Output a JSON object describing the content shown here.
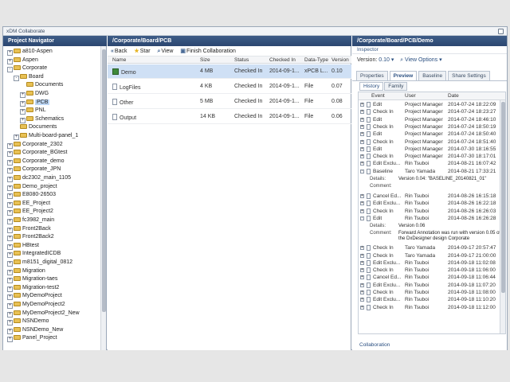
{
  "app_title": "xDM Collaborate",
  "panels": {
    "navigator_title": "Project Navigator",
    "middle_path": "/Corporate/Board/PCB",
    "right_path": "/Corporate/Board/PCB/Demo",
    "inspector_label": "Inspector"
  },
  "navigator": {
    "items": [
      {
        "label": "a810-Aspen",
        "indent": 0,
        "toggle": "+"
      },
      {
        "label": "Aspen",
        "indent": 0,
        "toggle": "+"
      },
      {
        "label": "Corporate",
        "indent": 0,
        "toggle": "-"
      },
      {
        "label": "Board",
        "indent": 1,
        "toggle": "-"
      },
      {
        "label": "Documents",
        "indent": 2,
        "toggle": ""
      },
      {
        "label": "DWG",
        "indent": 2,
        "toggle": "+"
      },
      {
        "label": "PCB",
        "indent": 2,
        "toggle": "+",
        "selected": true
      },
      {
        "label": "PNL",
        "indent": 2,
        "toggle": "+"
      },
      {
        "label": "Schematics",
        "indent": 2,
        "toggle": "+"
      },
      {
        "label": "Documents",
        "indent": 1,
        "toggle": ""
      },
      {
        "label": "Multi-board-panel_1",
        "indent": 1,
        "toggle": "+"
      },
      {
        "label": "Corporate_2302",
        "indent": 0,
        "toggle": "+"
      },
      {
        "label": "Corporate_BGtest",
        "indent": 0,
        "toggle": "+"
      },
      {
        "label": "Corporate_demo",
        "indent": 0,
        "toggle": "+"
      },
      {
        "label": "Corporate_JPN",
        "indent": 0,
        "toggle": "+"
      },
      {
        "label": "dc2302_main_1105",
        "indent": 0,
        "toggle": "+"
      },
      {
        "label": "Demo_project",
        "indent": 0,
        "toggle": "+"
      },
      {
        "label": "E8080-26503",
        "indent": 0,
        "toggle": "+"
      },
      {
        "label": "EE_Project",
        "indent": 0,
        "toggle": "+"
      },
      {
        "label": "EE_Project2",
        "indent": 0,
        "toggle": "+"
      },
      {
        "label": "fc3982_main",
        "indent": 0,
        "toggle": "+"
      },
      {
        "label": "Front2Back",
        "indent": 0,
        "toggle": "+"
      },
      {
        "label": "Front2Back2",
        "indent": 0,
        "toggle": "+"
      },
      {
        "label": "HBtest",
        "indent": 0,
        "toggle": "+"
      },
      {
        "label": "IntegratedICDB",
        "indent": 0,
        "toggle": "+"
      },
      {
        "label": "m8151_digital_0812",
        "indent": 0,
        "toggle": "+"
      },
      {
        "label": "Migration",
        "indent": 0,
        "toggle": "+"
      },
      {
        "label": "Migration-taes",
        "indent": 0,
        "toggle": "+"
      },
      {
        "label": "Migration-test2",
        "indent": 0,
        "toggle": "+"
      },
      {
        "label": "MyDemoProject",
        "indent": 0,
        "toggle": "+"
      },
      {
        "label": "MyDemoProject2",
        "indent": 0,
        "toggle": "+"
      },
      {
        "label": "MyDemoProject2_New",
        "indent": 0,
        "toggle": "+"
      },
      {
        "label": "NSNDemo",
        "indent": 0,
        "toggle": "+"
      },
      {
        "label": "NSNDemo_New",
        "indent": 0,
        "toggle": "+"
      },
      {
        "label": "Panel_Project",
        "indent": 0,
        "toggle": "+"
      }
    ]
  },
  "toolbar": {
    "back_label": "Back",
    "star_label": "Star",
    "view_label": "View",
    "finish_label": "Finish Collaboration"
  },
  "files": {
    "columns": [
      "Name",
      "Size",
      "Status",
      "Checked In",
      "Data-Type",
      "Version"
    ],
    "rows": [
      {
        "name": "Demo",
        "size": "4 MB",
        "status": "Checked In",
        "checked_in": "2014-09-1...",
        "type": "xPCB L...",
        "version": "0.10",
        "selected": true,
        "icon": "pcb"
      },
      {
        "name": "LogFiles",
        "size": "4 KB",
        "status": "Checked In",
        "checked_in": "2014-09-1...",
        "type": "File",
        "version": "0.07",
        "icon": "file"
      },
      {
        "name": "Other",
        "size": "5 MB",
        "status": "Checked In",
        "checked_in": "2014-09-1...",
        "type": "File",
        "version": "0.08",
        "icon": "file"
      },
      {
        "name": "Output",
        "size": "14 KB",
        "status": "Checked In",
        "checked_in": "2014-09-1...",
        "type": "File",
        "version": "0.06",
        "icon": "file"
      }
    ]
  },
  "inspector": {
    "version_label": "Version:",
    "version_value": "0.10",
    "view_options_label": "View Options",
    "tabs": [
      "Properties",
      "Preview",
      "Baseline",
      "Share Settings"
    ],
    "active_tab": "Preview",
    "subtabs": [
      "History",
      "Family"
    ],
    "history_columns": [
      "Event",
      "User",
      "Date"
    ],
    "history": [
      {
        "event": "Edit",
        "user": "Project Manager",
        "date": "2014-07-24 18:22:09"
      },
      {
        "event": "Check In",
        "user": "Project Manager",
        "date": "2014-07-24 18:23:27"
      },
      {
        "event": "Edit",
        "user": "Project Manager",
        "date": "2014-07-24 18:46:10"
      },
      {
        "event": "Check In",
        "user": "Project Manager",
        "date": "2014-07-24 18:50:19"
      },
      {
        "event": "Edit",
        "user": "Project Manager",
        "date": "2014-07-24 18:50:40"
      },
      {
        "event": "Check In",
        "user": "Project Manager",
        "date": "2014-07-24 18:51:40"
      },
      {
        "event": "Edit",
        "user": "Project Manager",
        "date": "2014-07-30 18:16:55"
      },
      {
        "event": "Check In",
        "user": "Project Manager",
        "date": "2014-07-30 18:17:01"
      },
      {
        "event": "Edit Exclu...",
        "user": "Rin Tsuboi",
        "date": "2014-08-21 16:07:42"
      },
      {
        "event": "Baseline",
        "user": "Taro Yamada",
        "date": "2014-08-21 17:33:21",
        "expanded": true,
        "details": "Version 0.04: \"BASELINE_20140821_01\"",
        "comment": ""
      },
      {
        "event": "Cancel Ed...",
        "user": "Rin Tsuboi",
        "date": "2014-08-26 16:15:18"
      },
      {
        "event": "Edit Exclu...",
        "user": "Rin Tsuboi",
        "date": "2014-08-26 16:22:18"
      },
      {
        "event": "Check In",
        "user": "Rin Tsuboi",
        "date": "2014-08-26 16:26:03"
      },
      {
        "event": "Edit",
        "user": "Rin Tsuboi",
        "date": "2014-08-26 16:26:28",
        "expanded": true,
        "details": "Version 0.06",
        "comment": "Forward Annotation was run with version 0.05 of",
        "comment2": "the DxDesigner design Corporate"
      },
      {
        "event": "Check In",
        "user": "Taro Yamada",
        "date": "2014-09-17 20:57:47"
      },
      {
        "event": "Check In",
        "user": "Taro Yamada",
        "date": "2014-09-17 21:00:00"
      },
      {
        "event": "Edit Exclu...",
        "user": "Rin Tsuboi",
        "date": "2014-09-18 11:02:08"
      },
      {
        "event": "Check In",
        "user": "Rin Tsuboi",
        "date": "2014-09-18 11:06:00"
      },
      {
        "event": "Cancel Ed...",
        "user": "Rin Tsuboi",
        "date": "2014-09-18 11:06:44"
      },
      {
        "event": "Edit Exclu...",
        "user": "Rin Tsuboi",
        "date": "2014-09-18 11:07:20"
      },
      {
        "event": "Check In",
        "user": "Rin Tsuboi",
        "date": "2014-09-18 11:08:00"
      },
      {
        "event": "Edit Exclu...",
        "user": "Rin Tsuboi",
        "date": "2014-09-18 11:10:20"
      },
      {
        "event": "Check In",
        "user": "Rin Tsuboi",
        "date": "2014-09-18 11:12:00"
      }
    ],
    "details_label": "Details:",
    "comment_label": "Comment:",
    "footer_link": "Collaboration"
  },
  "colors": {
    "header_bg": "#2b4670",
    "selection": "#bcd6f5",
    "link": "#2a4f80"
  }
}
